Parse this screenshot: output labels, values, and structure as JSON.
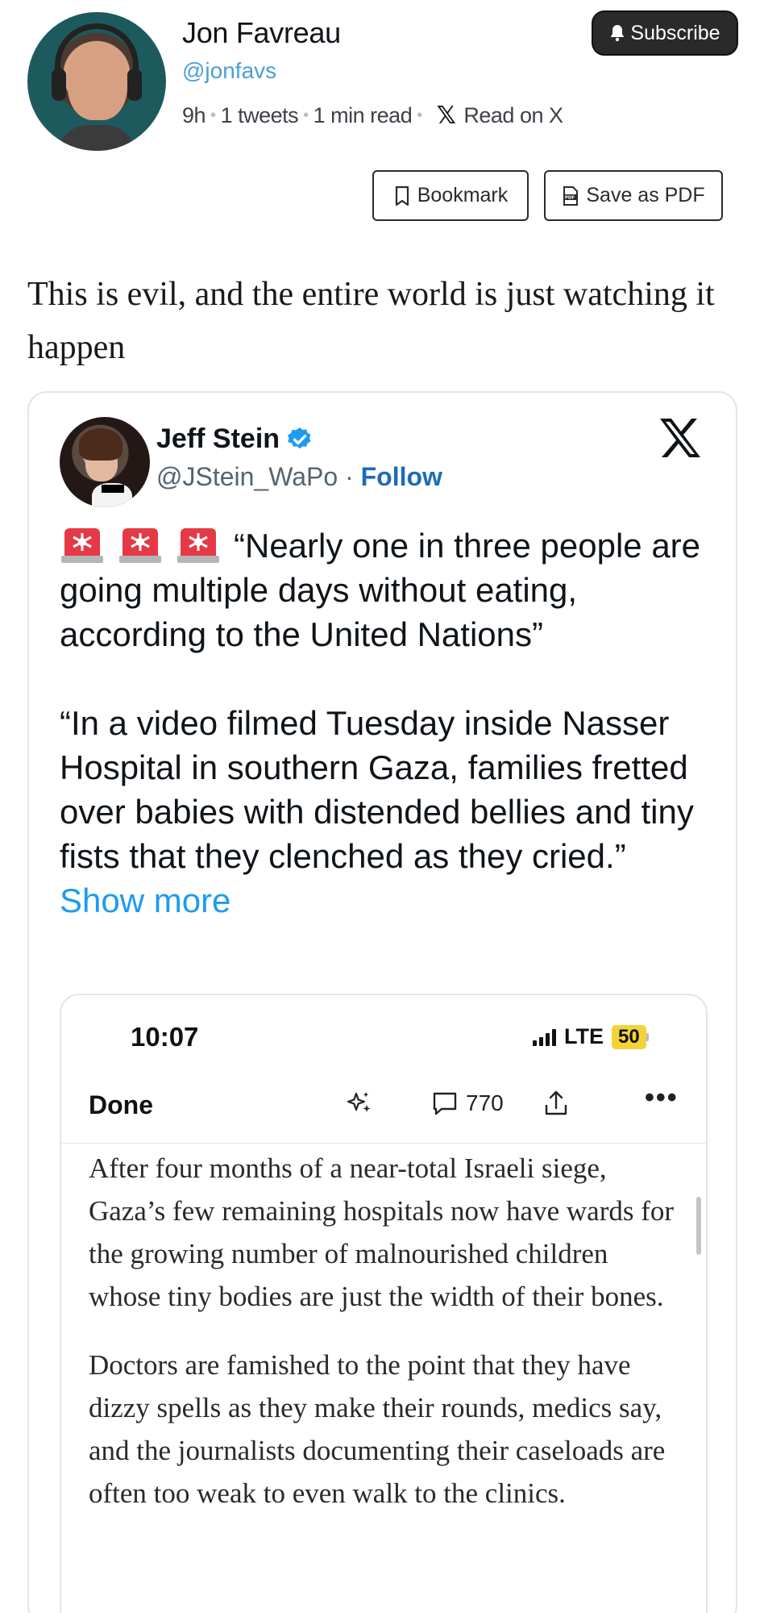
{
  "header": {
    "author_name": "Jon Favreau",
    "author_handle": "@jonfavs",
    "meta": {
      "age": "9h",
      "tweets": "1 tweets",
      "read_time": "1 min read",
      "read_on_x": "Read on X"
    },
    "subscribe_label": "Subscribe",
    "bookmark_label": "Bookmark",
    "save_pdf_label": "Save as PDF"
  },
  "tweet": {
    "text": "This is evil, and the entire world is just watching it happen"
  },
  "embedded": {
    "name": "Jeff Stein",
    "handle": "@JStein_WaPo",
    "separator": "·",
    "follow_label": "Follow",
    "para1": "“Nearly one in three people are going multiple days without eating, according to the United Nations”",
    "para2": "“In a video filmed Tuesday inside Nasser Hospital in southern Gaza, families fretted over babies with distended bellies and tiny fists that they clenched as they cried.”",
    "show_more": "Show more",
    "emoji": "rotating-light-icon"
  },
  "screenshot": {
    "time": "10:07",
    "network": "LTE",
    "battery": "50",
    "done_label": "Done",
    "comment_count": "770",
    "article_p1": "After four months of a near-total Israeli siege, Gaza’s few remaining hospitals now have wards for the growing number of malnourished children whose tiny bodies are just the width of their bones.",
    "article_p2": "Doctors are famished to the point that they have dizzy spells as they make their rounds, medics say, and the journalists documenting their caseloads are often too weak to even walk to the clinics."
  },
  "colors": {
    "link": "#1d9bf0",
    "handle": "#4a9fd8",
    "follow": "#1d6bb8",
    "battery": "#f4d33a"
  }
}
